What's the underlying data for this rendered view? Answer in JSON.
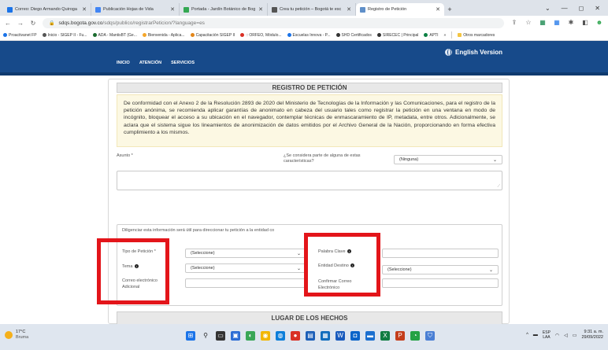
{
  "browser": {
    "tabs": [
      {
        "title": "Correo: Diego Armando Quiroga",
        "color": "#1a73e8",
        "active": false
      },
      {
        "title": "Publicación Hojas de Vida",
        "color": "#4285f4",
        "active": false
      },
      {
        "title": "Portada - Jardín Botánico de Bog",
        "color": "#34a853",
        "active": false
      },
      {
        "title": "Crea tu petición – Bogotá te esc",
        "color": "#555555",
        "active": false
      },
      {
        "title": "Registro de Petición",
        "color": "#5f8fc9",
        "active": true
      }
    ],
    "new_tab_label": "+",
    "url_main": "sdqs.bogota.gov.co",
    "url_path": "/sdqs/publico/registrarPeticion/?language=es",
    "bookmarks": [
      {
        "label": "Proactivanet FP",
        "color": "#1a73e8"
      },
      {
        "label": "Inicio - SIGEP II - Fu...",
        "color": "#555555"
      },
      {
        "label": "ADA - MantisBT (Ge...",
        "color": "#1b6b2f"
      },
      {
        "label": "Bienvenida - Aplica...",
        "color": "#f4a62a"
      },
      {
        "label": "Capacitación SIGEP II",
        "color": "#e2861a"
      },
      {
        "label": ":: ORFEO, Módulo...",
        "color": "#d93025"
      },
      {
        "label": "Escuelas Innova - P...",
        "color": "#1a73e8"
      },
      {
        "label": "SHD Certificados",
        "color": "#333333"
      },
      {
        "label": "SIRECEC | Principal",
        "color": "#333333"
      },
      {
        "label": "APTI",
        "color": "#0b8043"
      }
    ],
    "bookmarks_more": "»",
    "other_bookmarks": "Otros marcadores"
  },
  "site": {
    "menu": [
      "INICIO",
      "ATENCIÓN",
      "SERVICIOS"
    ],
    "english_label": "English Version"
  },
  "form": {
    "title": "REGISTRO DE PETICIÓN",
    "notice": "De conformidad con el Anexo 2 de la Resolución 2893 de 2020 del Ministerio de Tecnologías de la Información y las Comunicaciones, para el registro de la petición anónima, se recomienda aplicar garantías de anonimato en cabeza del usuario tales como registrar la petición en una ventana en modo de incógnito, bloquear el acceso a su ubicación en el navegador, contemplar técnicas de enmascaramiento de IP, metadata, entre otros. Adicionalmente, se aclara que el sistema sigue los lineamientos de anonimización de datos emitidos por el Archivo General de la Nación, proporcionando en forma efectiva cumplimiento a los mismos.",
    "asunto_label": "Asunto *",
    "poblacion_label": "¿Se considera parte de alguna de estas características?",
    "poblacion_value": "(Ninguna)",
    "info_text": "Diligenciar esta información será útil para direccionar tu petición a la entidad co",
    "tipo_label": "Tipo de Petición *",
    "tipo_value": "(Seleccione)",
    "tema_label": "Tema",
    "tema_value": "(Seleccione)",
    "correo_label_1": "Correo electrónico",
    "correo_label_2": "Adicional",
    "palabra_label": "Palabra Clave",
    "entidad_label": "Entidad Destino",
    "entidad_value": "(Seleccione)",
    "confirm_label_1": "Confirmar Correo",
    "confirm_label_2": "Electrónico",
    "lugar_title": "LUGAR DE LOS HECHOS"
  },
  "taskbar": {
    "temp": "17°C",
    "condition": "Bruma",
    "lang_1": "ESP",
    "lang_2": "LAA",
    "time": "9:31 a. m.",
    "date": "29/09/2022"
  }
}
